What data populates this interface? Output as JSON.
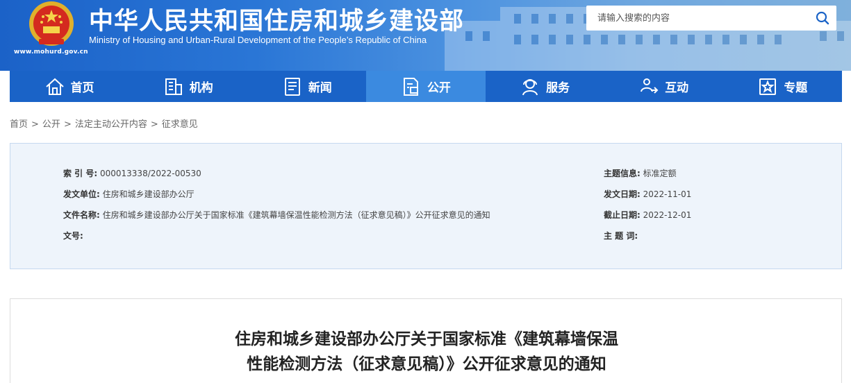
{
  "header": {
    "title_cn": "中华人民共和国住房和城乡建设部",
    "title_en": "Ministry of Housing and Urban-Rural Development of the People’s Republic of China",
    "site_url": "www.mohurd.gov.cn",
    "emblem_icon": "national-emblem-icon"
  },
  "search": {
    "placeholder": "请输入搜索的内容",
    "value": "",
    "icon": "search-icon"
  },
  "nav": {
    "items": [
      {
        "label": "首页",
        "icon": "home-icon",
        "active": false
      },
      {
        "label": "机构",
        "icon": "building-icon",
        "active": false
      },
      {
        "label": "新闻",
        "icon": "news-icon",
        "active": false
      },
      {
        "label": "公开",
        "icon": "disclosure-icon",
        "active": true
      },
      {
        "label": "服务",
        "icon": "service-icon",
        "active": false
      },
      {
        "label": "互动",
        "icon": "interaction-icon",
        "active": false
      },
      {
        "label": "专题",
        "icon": "topic-star-icon",
        "active": false
      }
    ],
    "active_bg": "#3b8ae0",
    "bg": "#1a63c7"
  },
  "breadcrumb": {
    "items": [
      "首页",
      "公开",
      "法定主动公开内容",
      "征求意见"
    ],
    "separator": ">"
  },
  "info": {
    "index_label": "索 引 号:",
    "index_value": "000013338/2022-00530",
    "issuer_label": "发文单位:",
    "issuer_value": "住房和城乡建设部办公厅",
    "filename_label": "文件名称:",
    "filename_value": "住房和城乡建设部办公厅关于国家标准《建筑幕墙保温性能检测方法（征求意见稿）》公开征求意见的通知",
    "docno_label_1": "文",
    "docno_label_2": "号:",
    "docno_value": "",
    "topic_label": "主题信息:",
    "topic_value": "标准定额",
    "date_label": "发文日期:",
    "date_value": "2022-11-01",
    "deadline_label": "截止日期:",
    "deadline_value": "2022-12-01",
    "keywords_label": "主 题 词:",
    "keywords_value": ""
  },
  "article": {
    "title_line1": "住房和城乡建设部办公厅关于国家标准《建筑幕墙保温",
    "title_line2": "性能检测方法（征求意见稿）》公开征求意见的通知"
  }
}
